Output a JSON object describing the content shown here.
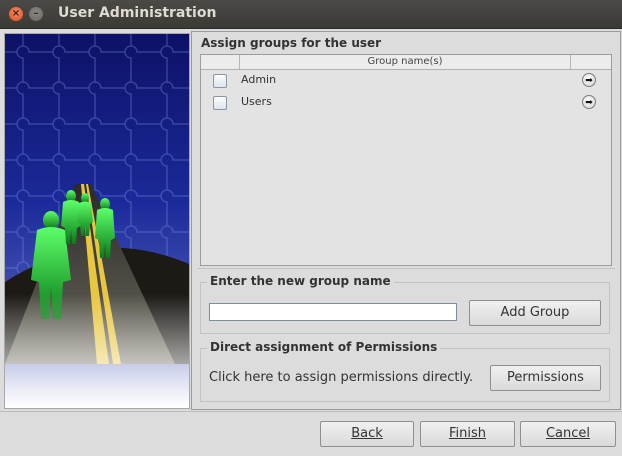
{
  "window": {
    "title": "User Administration",
    "close_glyph": "×",
    "min_glyph": "–"
  },
  "groups_panel": {
    "title": "Assign groups for the user",
    "column_header": "Group name(s)",
    "rows": [
      {
        "name": "Admin",
        "checked": false,
        "action_icon": "arrow-right-icon"
      },
      {
        "name": "Users",
        "checked": false,
        "action_icon": "arrow-right-icon"
      }
    ],
    "arrow_glyph": "➡"
  },
  "new_group": {
    "title": "Enter the new group name",
    "input_value": "",
    "add_label": "Add Group"
  },
  "permissions": {
    "title": "Direct assignment of Permissions",
    "text": "Click here to assign permissions directly.",
    "button_label": "Permissions"
  },
  "footer": {
    "back_label": "Back",
    "finish_label": "Finish",
    "cancel_label": "Cancel"
  },
  "side_image": {
    "description_icon": "puzzle-road-figures-image"
  }
}
